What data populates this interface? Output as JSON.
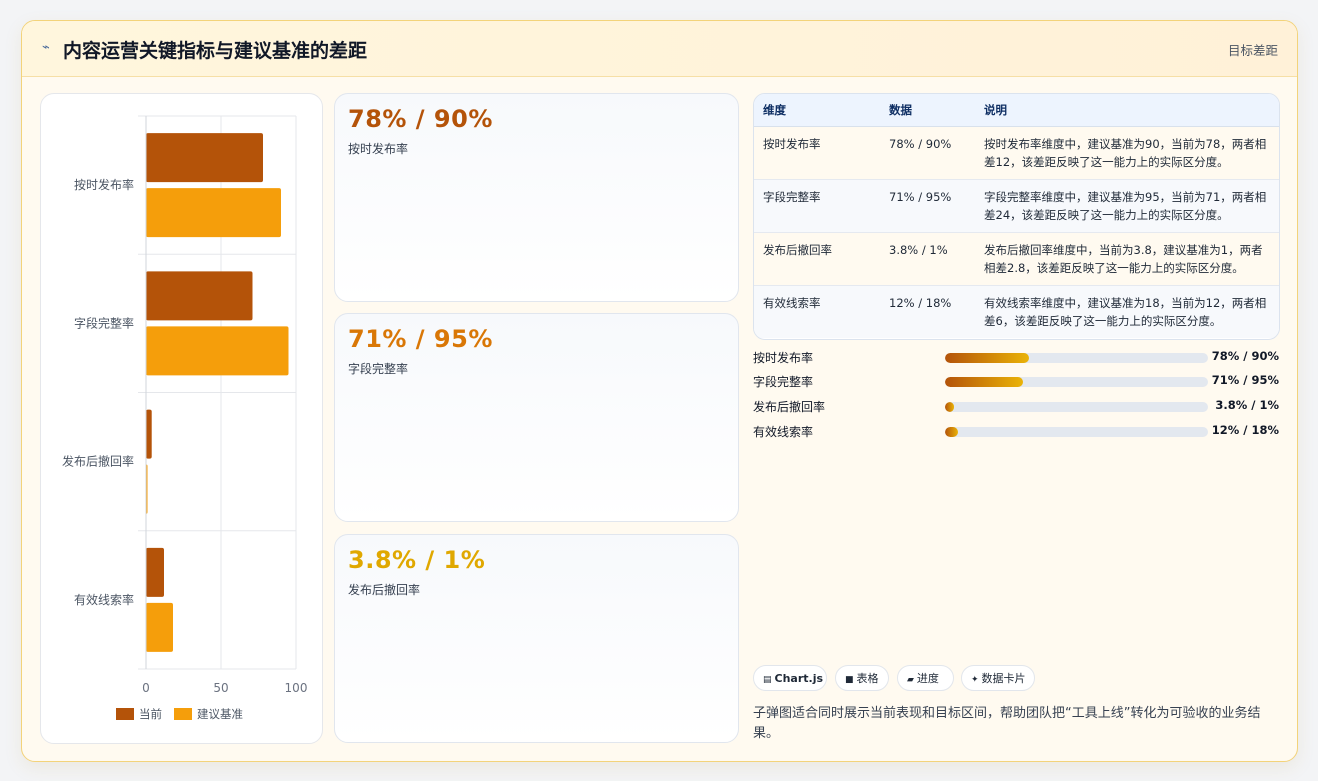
{
  "header": {
    "icon": "chart-line-icon",
    "title": "内容运营关键指标与建议基准的差距",
    "badge": "目标差距"
  },
  "colors": {
    "current": "#b45309",
    "benchmark": "#f59e0b",
    "kpi1": "#b45309",
    "kpi2": "#d97706",
    "kpi3": "#e6a700"
  },
  "chart_data": {
    "type": "bar",
    "orientation": "horizontal",
    "categories": [
      "按时发布率",
      "字段完整率",
      "发布后撤回率",
      "有效线索率"
    ],
    "series": [
      {
        "name": "当前",
        "values": [
          78,
          71,
          3.8,
          12
        ],
        "color": "#b45309"
      },
      {
        "name": "建议基准",
        "values": [
          90,
          95,
          1,
          18
        ],
        "color": "#f59e0b"
      }
    ],
    "xlim": [
      0,
      100
    ],
    "xticks": [
      "0",
      "50",
      "100"
    ],
    "grid": true,
    "legend": "bottom"
  },
  "kpis": [
    {
      "value": "78% / 90%",
      "label": "按时发布率"
    },
    {
      "value": "71% / 95%",
      "label": "字段完整率"
    },
    {
      "value": "3.8% / 1%",
      "label": "发布后撤回率"
    }
  ],
  "table": {
    "headers": [
      "维度",
      "数据",
      "说明"
    ],
    "rows": [
      {
        "dim": "按时发布率",
        "data": "78% / 90%",
        "desc": "按时发布率维度中，建议基准为90，当前为78，两者相差12，该差距反映了这一能力上的实际区分度。"
      },
      {
        "dim": "字段完整率",
        "data": "71% / 95%",
        "desc": "字段完整率维度中，建议基准为95，当前为71，两者相差24，该差距反映了这一能力上的实际区分度。"
      },
      {
        "dim": "发布后撤回率",
        "data": "3.8% / 1%",
        "desc": "发布后撤回率维度中，当前为3.8，建议基准为1，两者相差2.8，该差距反映了这一能力上的实际区分度。"
      },
      {
        "dim": "有效线索率",
        "data": "12% / 18%",
        "desc": "有效线索率维度中，建议基准为18，当前为12，两者相差6，该差距反映了这一能力上的实际区分度。"
      }
    ]
  },
  "progress": [
    {
      "label": "按时发布率",
      "value_text": "78% / 90%",
      "fraction": 0.32
    },
    {
      "label": "字段完整率",
      "value_text": "71% / 95%",
      "fraction": 0.295
    },
    {
      "label": "发布后撤回率",
      "value_text": "3.8% / 1%",
      "fraction": 0.035
    },
    {
      "label": "有效线索率",
      "value_text": "12% / 18%",
      "fraction": 0.05
    }
  ],
  "tags": [
    {
      "icon": "▤",
      "label": "Chart.js"
    },
    {
      "icon": "■",
      "label": "表格"
    },
    {
      "icon": "▰",
      "label": "进度"
    },
    {
      "icon": "✦",
      "label": "数据卡片"
    }
  ],
  "note": "子弹图适合同时展示当前表现和目标区间，帮助团队把“工具上线”转化为可验收的业务结果。"
}
